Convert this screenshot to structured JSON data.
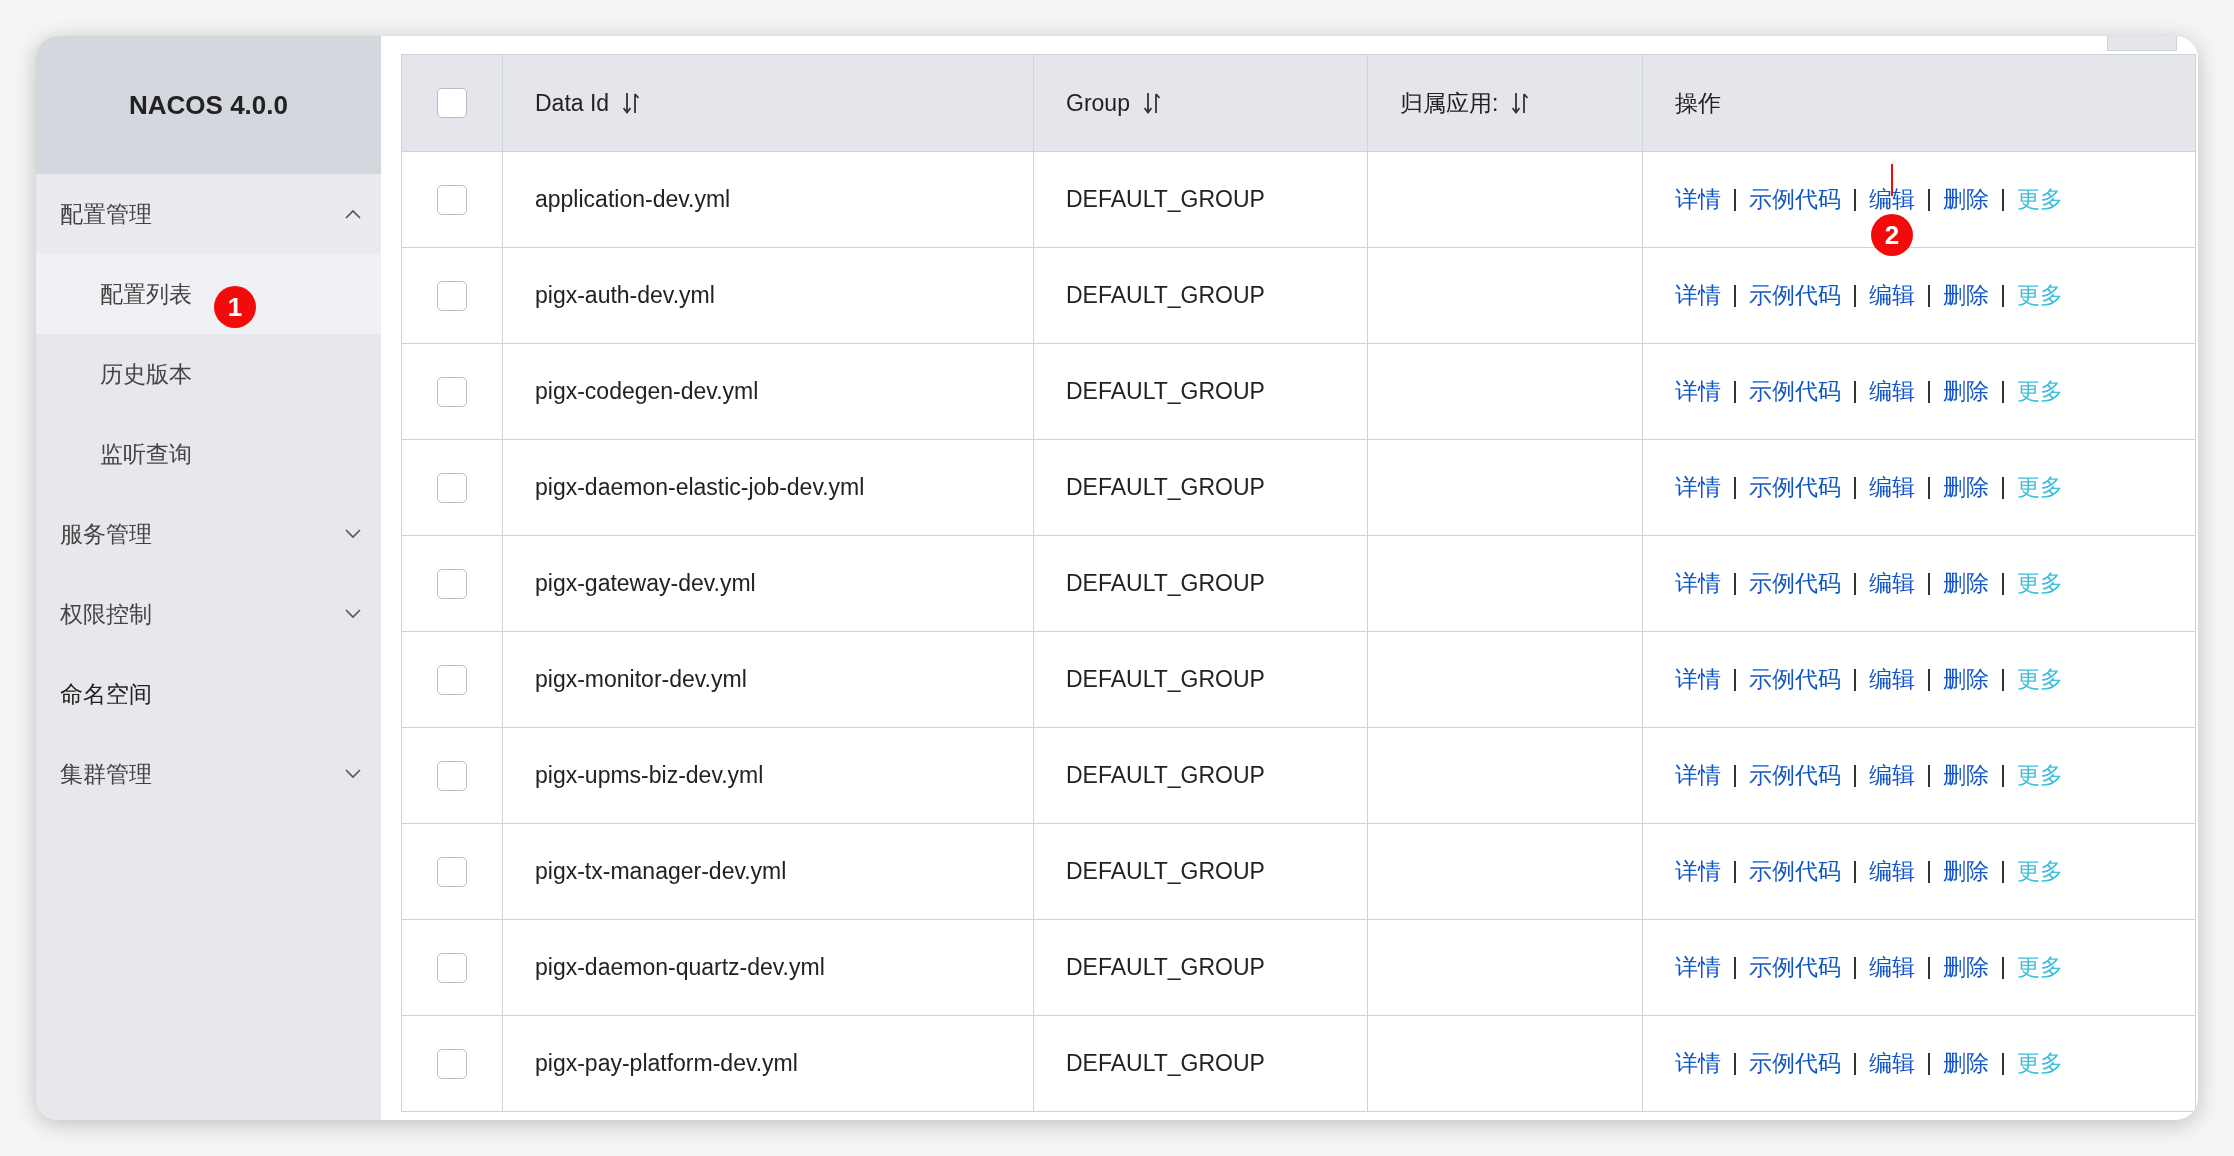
{
  "sidebar": {
    "title": "NACOS 4.0.0",
    "items": [
      {
        "label": "配置管理",
        "kind": "group",
        "expanded": true,
        "children": [
          {
            "label": "配置列表",
            "selected": true
          },
          {
            "label": "历史版本",
            "selected": false
          },
          {
            "label": "监听查询",
            "selected": false
          }
        ]
      },
      {
        "label": "服务管理",
        "kind": "group",
        "expanded": false
      },
      {
        "label": "权限控制",
        "kind": "group",
        "expanded": false
      },
      {
        "label": "命名空间",
        "kind": "link"
      },
      {
        "label": "集群管理",
        "kind": "group",
        "expanded": false
      }
    ]
  },
  "table": {
    "select_all": {
      "checked": false
    },
    "columns": [
      {
        "label": "Data Id",
        "sortable": true
      },
      {
        "label": "Group",
        "sortable": true
      },
      {
        "label": "归属应用:",
        "sortable": true
      },
      {
        "label": "操作",
        "sortable": false
      }
    ],
    "rows": [
      {
        "checked": false,
        "data_id": "application-dev.yml",
        "group": "DEFAULT_GROUP",
        "actions": [
          {
            "label": "详情",
            "kind": "link"
          },
          {
            "label": "示例代码",
            "kind": "link"
          },
          {
            "label": "编辑",
            "kind": "link"
          },
          {
            "label": "删除",
            "kind": "link"
          },
          {
            "label": "更多",
            "kind": "menu"
          }
        ]
      },
      {
        "checked": false,
        "data_id": "pigx-auth-dev.yml",
        "group": "DEFAULT_GROUP",
        "actions": [
          {
            "label": "详情",
            "kind": "link"
          },
          {
            "label": "示例代码",
            "kind": "link"
          },
          {
            "label": "编辑",
            "kind": "link"
          },
          {
            "label": "删除",
            "kind": "link"
          },
          {
            "label": "更多",
            "kind": "menu"
          }
        ]
      },
      {
        "checked": false,
        "data_id": "pigx-codegen-dev.yml",
        "group": "DEFAULT_GROUP",
        "actions": [
          {
            "label": "详情",
            "kind": "link"
          },
          {
            "label": "示例代码",
            "kind": "link"
          },
          {
            "label": "编辑",
            "kind": "link"
          },
          {
            "label": "删除",
            "kind": "link"
          },
          {
            "label": "更多",
            "kind": "menu"
          }
        ]
      },
      {
        "checked": false,
        "data_id": "pigx-daemon-elastic-job-dev.yml",
        "group": "DEFAULT_GROUP",
        "actions": [
          {
            "label": "详情",
            "kind": "link"
          },
          {
            "label": "示例代码",
            "kind": "link"
          },
          {
            "label": "编辑",
            "kind": "link"
          },
          {
            "label": "删除",
            "kind": "link"
          },
          {
            "label": "更多",
            "kind": "menu"
          }
        ]
      },
      {
        "checked": false,
        "data_id": "pigx-gateway-dev.yml",
        "group": "DEFAULT_GROUP",
        "actions": [
          {
            "label": "详情",
            "kind": "link"
          },
          {
            "label": "示例代码",
            "kind": "link"
          },
          {
            "label": "编辑",
            "kind": "link"
          },
          {
            "label": "删除",
            "kind": "link"
          },
          {
            "label": "更多",
            "kind": "menu"
          }
        ]
      },
      {
        "checked": false,
        "data_id": "pigx-monitor-dev.yml",
        "group": "DEFAULT_GROUP",
        "actions": [
          {
            "label": "详情",
            "kind": "link"
          },
          {
            "label": "示例代码",
            "kind": "link"
          },
          {
            "label": "编辑",
            "kind": "link"
          },
          {
            "label": "删除",
            "kind": "link"
          },
          {
            "label": "更多",
            "kind": "menu"
          }
        ]
      },
      {
        "checked": false,
        "data_id": "pigx-upms-biz-dev.yml",
        "group": "DEFAULT_GROUP",
        "actions": [
          {
            "label": "详情",
            "kind": "link"
          },
          {
            "label": "示例代码",
            "kind": "link"
          },
          {
            "label": "编辑",
            "kind": "link"
          },
          {
            "label": "删除",
            "kind": "link"
          },
          {
            "label": "更多",
            "kind": "menu"
          }
        ]
      },
      {
        "checked": false,
        "data_id": "pigx-tx-manager-dev.yml",
        "group": "DEFAULT_GROUP",
        "actions": [
          {
            "label": "详情",
            "kind": "link"
          },
          {
            "label": "示例代码",
            "kind": "link"
          },
          {
            "label": "编辑",
            "kind": "link"
          },
          {
            "label": "删除",
            "kind": "link"
          },
          {
            "label": "更多",
            "kind": "menu"
          }
        ]
      },
      {
        "checked": false,
        "data_id": "pigx-daemon-quartz-dev.yml",
        "group": "DEFAULT_GROUP",
        "actions": [
          {
            "label": "详情",
            "kind": "link"
          },
          {
            "label": "示例代码",
            "kind": "link"
          },
          {
            "label": "编辑",
            "kind": "link"
          },
          {
            "label": "删除",
            "kind": "link"
          },
          {
            "label": "更多",
            "kind": "menu"
          }
        ]
      },
      {
        "checked": false,
        "data_id": "pigx-pay-platform-dev.yml",
        "group": "DEFAULT_GROUP",
        "actions": [
          {
            "label": "详情",
            "kind": "link"
          },
          {
            "label": "示例代码",
            "kind": "link"
          },
          {
            "label": "编辑",
            "kind": "link"
          },
          {
            "label": "删除",
            "kind": "link"
          },
          {
            "label": "更多",
            "kind": "menu"
          }
        ]
      }
    ]
  },
  "annotations": [
    {
      "label": "1",
      "leader": false
    },
    {
      "label": "2",
      "leader": true
    }
  ]
}
